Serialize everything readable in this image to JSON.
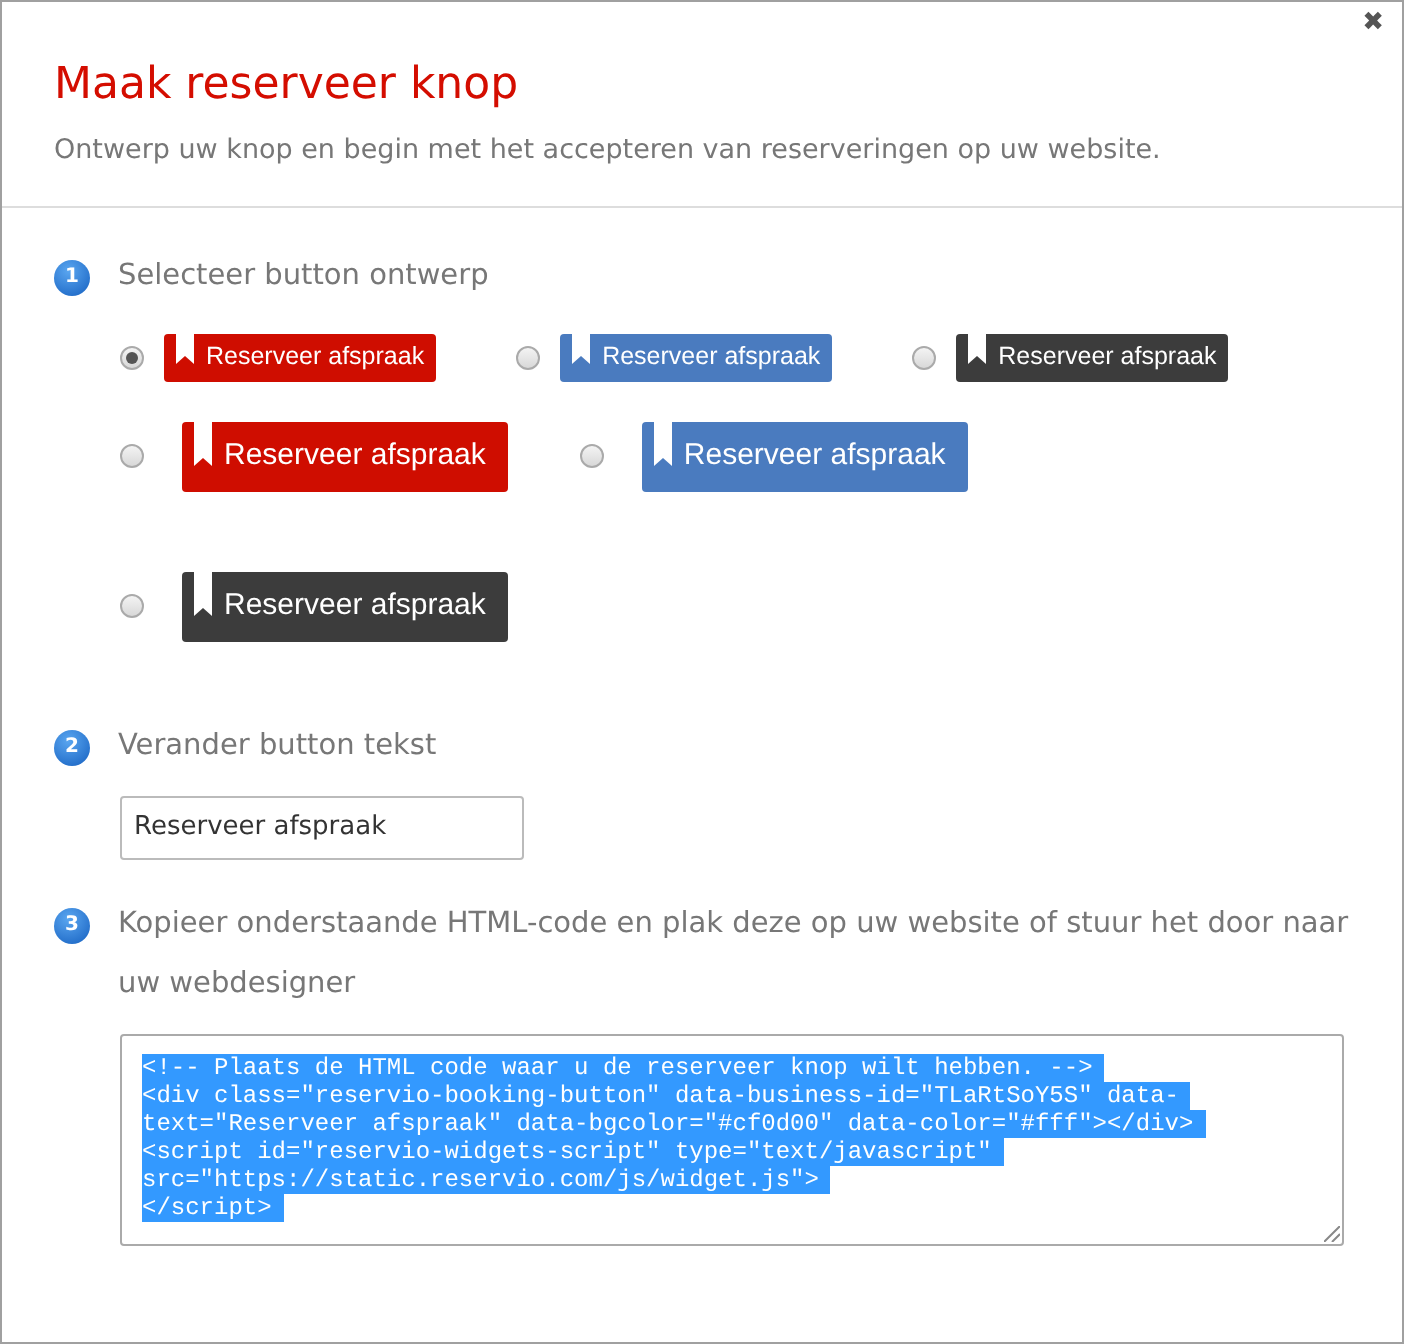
{
  "dialog": {
    "title": "Maak reserveer knop",
    "subtitle": "Ontwerp uw knop en begin met het accepteren van reserveringen op uw website.",
    "close": "✖"
  },
  "steps": [
    {
      "number": "1",
      "label": "Selecteer button ontwerp"
    },
    {
      "number": "2",
      "label": "Verander button tekst"
    },
    {
      "number": "3",
      "label": "Kopieer onderstaande HTML-code en plak deze op uw website of stuur het door naar uw webdesigner"
    }
  ],
  "designs": [
    [
      {
        "kind": "small",
        "color": "#cf0d00",
        "label": "Reserveer afspraak",
        "selected": true
      },
      {
        "kind": "small",
        "color": "#4a7bbf",
        "label": "Reserveer afspraak",
        "selected": false
      },
      {
        "kind": "small",
        "color": "#3c3c3c",
        "label": "Reserveer afspraak",
        "selected": false
      }
    ],
    [
      {
        "kind": "large",
        "color": "#cf0d00",
        "label": "Reserveer afspraak",
        "selected": false
      },
      {
        "kind": "large",
        "color": "#4a7bbf",
        "label": "Reserveer afspraak",
        "selected": false
      }
    ],
    [
      {
        "kind": "large",
        "color": "#3c3c3c",
        "label": "Reserveer afspraak",
        "selected": false
      }
    ]
  ],
  "button_text": {
    "value": "Reserveer afspraak"
  },
  "code": {
    "selected": true,
    "lines": [
      "<!-- Plaats de HTML code waar u de reserveer knop wilt hebben. -->",
      "<div class=\"reservio-booking-button\" data-business-id=\"TLaRtSoY5S\" data-",
      "text=\"Reserveer afspraak\" data-bgcolor=\"#cf0d00\" data-color=\"#fff\"></div>",
      "<script id=\"reservio-widgets-script\" type=\"text/javascript\"",
      "src=\"https://static.reservio.com/js/widget.js\">",
      "</script>"
    ]
  }
}
